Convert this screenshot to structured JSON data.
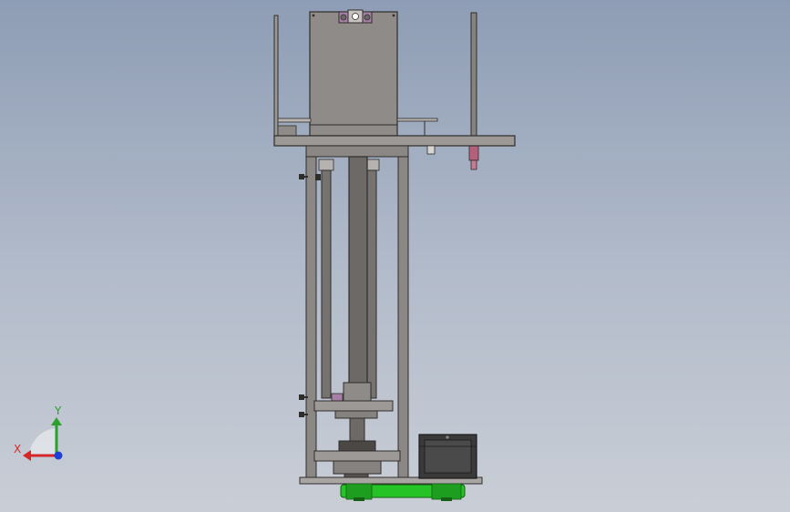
{
  "triad": {
    "y_label": "Y",
    "x_label": "X",
    "y_color": "#2ca02c",
    "x_color": "#d62728",
    "z_color": "#1f3fd6"
  },
  "colors": {
    "background_top": "#8e9db5",
    "background_bottom": "#c9ced6",
    "steel": "#8a8784",
    "steel_dark": "#55524f",
    "outline": "#2f2d2b",
    "belt": "#25c325",
    "motor": "#3a3a3a",
    "nozzle": "#b5607a",
    "bracket": "#a77ea6"
  }
}
